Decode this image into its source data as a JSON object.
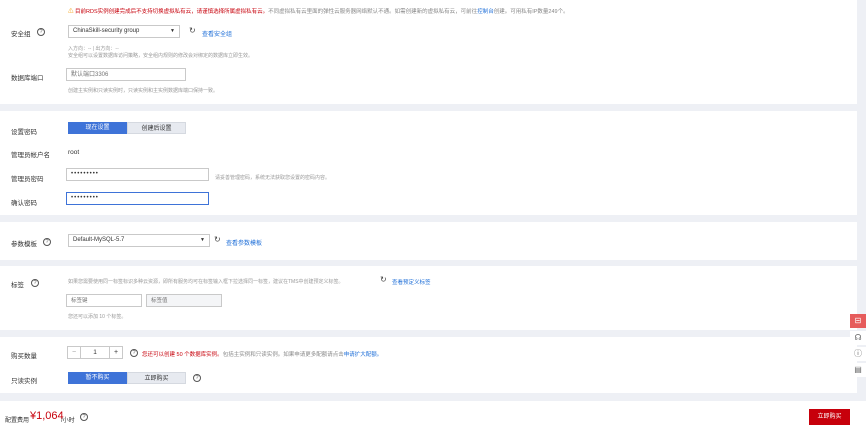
{
  "notice": {
    "text_red": "目前RDS实例创建完成后不支持切换虚拟私有云，请谨慎选择所属虚拟私有云。",
    "text_gray": "不同虚拟私有云里面的弹性云服务器网络默认不通。如需创建新的虚拟私有云，可前往",
    "link": "控制台",
    "text_tail": "创建。可用私有IP数量249个。"
  },
  "security_group": {
    "label": "安全组",
    "value": "ChinaSkill-security group",
    "link": "查看安全组",
    "info1": "入方向：-- | 出方向：--",
    "info2": "安全组可以设置数据库访问策略，安全组内规则的修改会对绑定的数据库立即生效。"
  },
  "db_port": {
    "label": "数据库端口",
    "placeholder": "默认端口3306",
    "hint": "创建主实例和只读实例时，只读实例和主实例数据库端口保持一致。"
  },
  "password": {
    "label": "设置密码",
    "option_now": "现在设置",
    "option_later": "创建后设置",
    "admin_label": "管理员帐户名",
    "admin_value": "root",
    "pwd_label": "管理员密码",
    "pwd_value": "•••••••••",
    "pwd_hint": "请妥善管理密码，系统无法获取您设置的密码内容。",
    "confirm_label": "确认密码",
    "confirm_value": "•••••••••"
  },
  "param_template": {
    "label": "参数模板",
    "value": "Default-MySQL-5.7",
    "link": "查看参数模板"
  },
  "tags": {
    "label": "标签",
    "desc": "如果您需要使用同一标签标识多种云资源，即所有服务均可在标签输入框下拉选择同一标签，建议在TMS中创建预定义标签。",
    "link": "查看预定义标签",
    "key_placeholder": "标签键",
    "value_placeholder": "标签值",
    "remaining": "您还可以添加 10 个标签。"
  },
  "quantity": {
    "label": "购买数量",
    "minus": "−",
    "value": "1",
    "plus": "+",
    "note_red": "您还可以创建 50 个数据库实例。",
    "note_gray": "包括主实例和只读实例。如果申请更多配额请点击",
    "note_link": "申请扩大配额。"
  },
  "readonly": {
    "label": "只读实例",
    "option_no": "暂不购买",
    "option_now": "立即购买"
  },
  "footer": {
    "price_label": "配置费用",
    "price_value": "¥1,064",
    "price_unit": "/小时",
    "buy_button": "立即购买"
  },
  "colors": {
    "accent": "#3e73d8",
    "danger": "#c7000b",
    "link": "#1f6fd8"
  },
  "side_icons": [
    "chat-icon",
    "headset-icon",
    "help-icon",
    "document-icon"
  ]
}
